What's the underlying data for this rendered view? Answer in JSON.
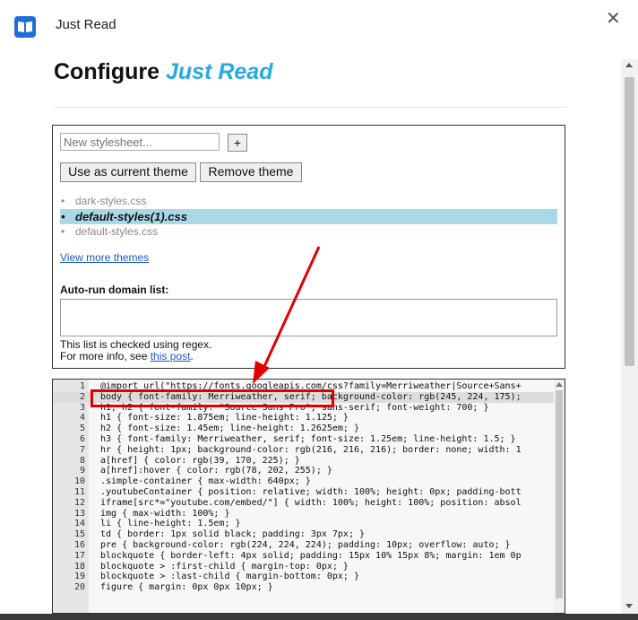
{
  "app": {
    "title": "Just Read",
    "close_glyph": "✕"
  },
  "page": {
    "heading_prefix": "Configure ",
    "heading_brand": "Just Read"
  },
  "stylesheet": {
    "new_placeholder": "New stylesheet...",
    "add_label": "+",
    "use_label": "Use as current theme",
    "remove_label": "Remove theme",
    "themes": [
      {
        "name": "dark-styles.css",
        "active": false
      },
      {
        "name": "default-styles(1).css",
        "active": true
      },
      {
        "name": "default-styles.css",
        "active": false
      }
    ],
    "more_link": "View more themes"
  },
  "autorun": {
    "label": "Auto-run domain list:",
    "help_line1": "This list is checked using regex.",
    "help_line2_prefix": "For more info, see ",
    "help_link": "this post",
    "help_line2_suffix": "."
  },
  "editor": {
    "lines": [
      {
        "n": "1",
        "text": "@import url(\"https://fonts.googleapis.com/css?family=Merriweather|Source+Sans+"
      },
      {
        "n": "2",
        "text": "body { font-family: Merriweather, serif; background-color: rgb(245, 224, 175);"
      },
      {
        "n": "3",
        "text": "h1, h2 { font-family: \"Source Sans Pro\", sans-serif; font-weight: 700; }"
      },
      {
        "n": "4",
        "text": "h1 { font-size: 1.875em; line-height: 1.125; }"
      },
      {
        "n": "5",
        "text": "h2 { font-size: 1.45em; line-height: 1.2625em; }"
      },
      {
        "n": "6",
        "text": "h3 { font-family: Merriweather, serif; font-size: 1.25em; line-height: 1.5; }"
      },
      {
        "n": "7",
        "text": "hr { height: 1px; background-color: rgb(216, 216, 216); border: none; width: 1"
      },
      {
        "n": "8",
        "text": "a[href] { color: rgb(39, 170, 225); }"
      },
      {
        "n": "9",
        "text": "a[href]:hover { color: rgb(78, 202, 255); }"
      },
      {
        "n": "10",
        "text": ".simple-container { max-width: 640px; }"
      },
      {
        "n": "11",
        "text": ".youtubeContainer { position: relative; width: 100%; height: 0px; padding-bott"
      },
      {
        "n": "12",
        "text": "iframe[src*=\"youtube.com/embed/\"] { width: 100%; height: 100%; position: absol"
      },
      {
        "n": "13",
        "text": "img { max-width: 100%; }"
      },
      {
        "n": "14",
        "text": "li { line-height: 1.5em; }"
      },
      {
        "n": "15",
        "text": "td { border: 1px solid black; padding: 3px 7px; }"
      },
      {
        "n": "16",
        "text": "pre { background-color: rgb(224, 224, 224); padding: 10px; overflow: auto; }"
      },
      {
        "n": "17",
        "text": "blockquote { border-left: 4px solid; padding: 15px 10% 15px 8%; margin: 1em 0p"
      },
      {
        "n": "18",
        "text": "blockquote > :first-child { margin-top: 0px; }"
      },
      {
        "n": "19",
        "text": "blockquote > :last-child { margin-bottom: 0px; }"
      },
      {
        "n": "20",
        "text": "figure { margin: 0px 0px 10px; }"
      }
    ]
  },
  "colors": {
    "brand": "#27aae1",
    "active_theme_bg": "#a9d8e6",
    "annotation_red": "#e00000"
  }
}
